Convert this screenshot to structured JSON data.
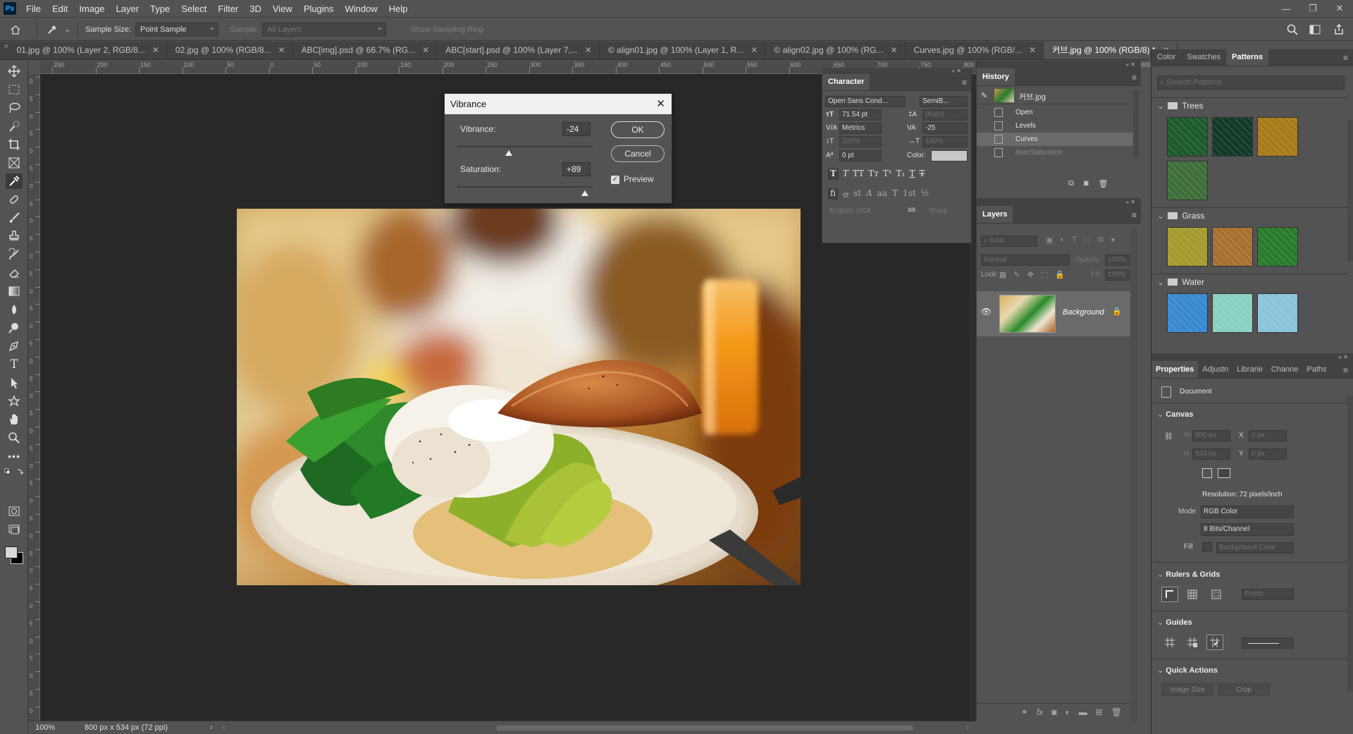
{
  "app": {
    "logo": "Ps"
  },
  "menu": [
    "File",
    "Edit",
    "Image",
    "Layer",
    "Type",
    "Select",
    "Filter",
    "3D",
    "View",
    "Plugins",
    "Window",
    "Help"
  ],
  "options_bar": {
    "sample_size_label": "Sample Size:",
    "sample_size_value": "Point Sample",
    "sample_label": "Sample:",
    "sample_value": "All Layers",
    "show_ring_label": "Show Sampling Ring"
  },
  "doc_tabs": [
    {
      "label": "01.jpg @ 100% (Layer 2, RGB/8...",
      "active": false
    },
    {
      "label": "02.jpg @ 100% (RGB/8...",
      "active": false
    },
    {
      "label": "ABC[img].psd @ 66.7% (RG...",
      "active": false
    },
    {
      "label": "ABC[start].psd @ 100% (Layer 7,...",
      "active": false
    },
    {
      "label": "© align01.jpg @ 100% (Layer 1, R...",
      "active": false
    },
    {
      "label": "© align02.jpg @ 100% (RG...",
      "active": false
    },
    {
      "label": "Curves.jpg @ 100% (RGB/...",
      "active": false
    },
    {
      "label": "커브.jpg @ 100% (RGB/8) *",
      "active": true
    }
  ],
  "ruler_top": [
    "250",
    "200",
    "150",
    "100",
    "50",
    "0",
    "50",
    "100",
    "150",
    "200",
    "250",
    "300",
    "350",
    "400",
    "450",
    "500",
    "550",
    "600",
    "650",
    "700",
    "750",
    "800",
    "850",
    "900",
    "950",
    "1000"
  ],
  "ruler_left": [
    "0",
    "5",
    "0",
    "5",
    "0",
    "5",
    "0",
    "5",
    "0",
    "5",
    "0",
    "5",
    "0",
    "5",
    "0",
    "5",
    "0",
    "5",
    "0",
    "5",
    "0",
    "5",
    "0",
    "5",
    "0",
    "5",
    "0",
    "5",
    "0",
    "5",
    "0",
    "5",
    "0",
    "5",
    "0",
    "5",
    "0"
  ],
  "status": {
    "zoom": "100%",
    "doc_info": "800 px x 534 px (72 ppi)"
  },
  "dialog": {
    "title": "Vibrance",
    "vibrance_label": "Vibrance:",
    "vibrance_value": "-24",
    "vibrance_level": -24,
    "saturation_label": "Saturation:",
    "saturation_value": "+89",
    "saturation_level": 89,
    "ok_label": "OK",
    "cancel_label": "Cancel",
    "preview_label": "Preview",
    "preview_checked": true
  },
  "character": {
    "title": "Character",
    "font_family": "Open Sans Cond...",
    "font_style": "SemiB...",
    "font_size": "71.54 pt",
    "leading": "(Auto)",
    "kerning": "Metrics",
    "tracking": "-25",
    "vscale": "100%",
    "hscale": "100%",
    "baseline": "0 pt",
    "color_label": "Color:",
    "language": "English: USA",
    "aa_label": "aa",
    "antialias": "Sharp"
  },
  "history": {
    "title": "History",
    "snapshot": "커브.jpg",
    "items": [
      "Open",
      "Levels",
      "Curves",
      "Hue/Saturation"
    ]
  },
  "layers": {
    "title": "Layers",
    "kind_label": "Kind",
    "blend_mode": "Normal",
    "opacity_label": "Opacity:",
    "opacity": "100%",
    "lock_label": "Lock:",
    "fill_label": "Fill:",
    "fill": "100%",
    "layer_name": "Background"
  },
  "patterns": {
    "tabs": [
      "Color",
      "Swatches",
      "Patterns"
    ],
    "search_placeholder": "Search Patterns",
    "groups": [
      {
        "name": "Trees",
        "colors": [
          "#1d5a2c",
          "#123a28",
          "#a87a1a",
          "#3e6e3a"
        ]
      },
      {
        "name": "Grass",
        "colors": [
          "#a49a30",
          "#a8702e",
          "#2a7a2e"
        ]
      },
      {
        "name": "Water",
        "colors": [
          "#3a88d0",
          "#8ad0c0",
          "#8ac4dc"
        ]
      }
    ]
  },
  "properties": {
    "tabs": [
      "Properties",
      "Adjustn",
      "Librarie",
      "Channe",
      "Paths"
    ],
    "doc_label": "Document",
    "canvas_section": "Canvas",
    "w_label": "W",
    "w_value": "800 px",
    "h_label": "H",
    "h_value": "534 px",
    "x_label": "X",
    "x_value": "0 px",
    "y_label": "Y",
    "y_value": "0 px",
    "resolution": "Resolution: 72 pixels/inch",
    "mode_label": "Mode",
    "mode_value": "RGB Color",
    "depth_value": "8 Bits/Channel",
    "fill_label": "Fill",
    "fill_value": "Background Color",
    "rulers_section": "Rulers & Grids",
    "units": "Pixels",
    "guides_section": "Guides",
    "quick_section": "Quick Actions",
    "image_size_btn": "Image Size",
    "crop_btn": "Crop"
  }
}
